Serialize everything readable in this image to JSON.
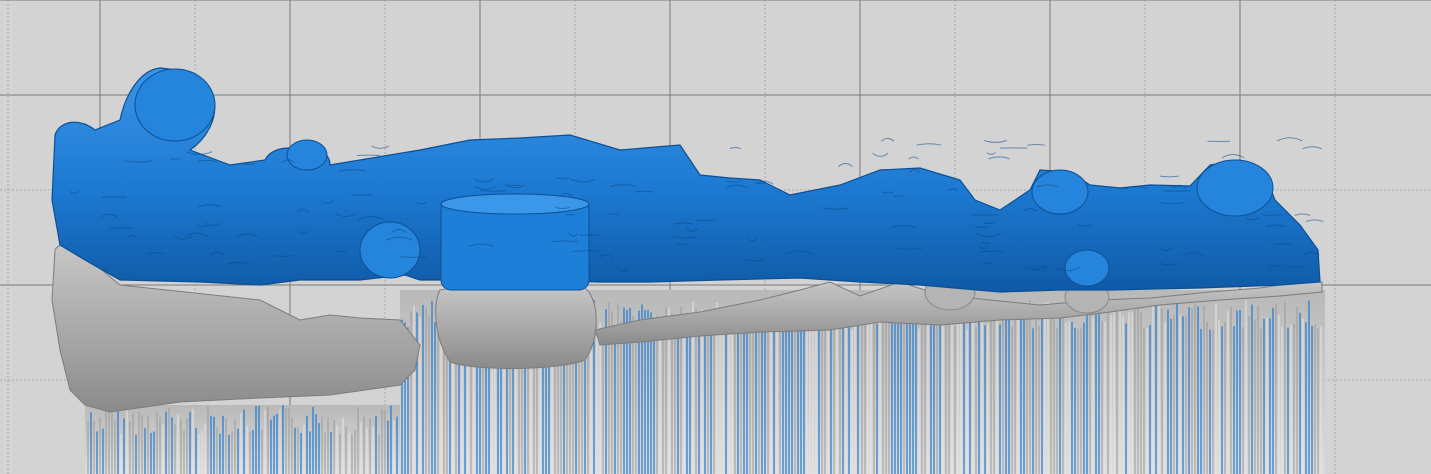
{
  "viewport": {
    "background_color": "#d3d3d3",
    "grid_major_color": "#7a7a7a",
    "grid_minor_color": "#a8a8a8",
    "model_primary_color": "#1c79d1",
    "model_secondary_color": "#a9a9a9",
    "support_pillars_visible": true
  }
}
